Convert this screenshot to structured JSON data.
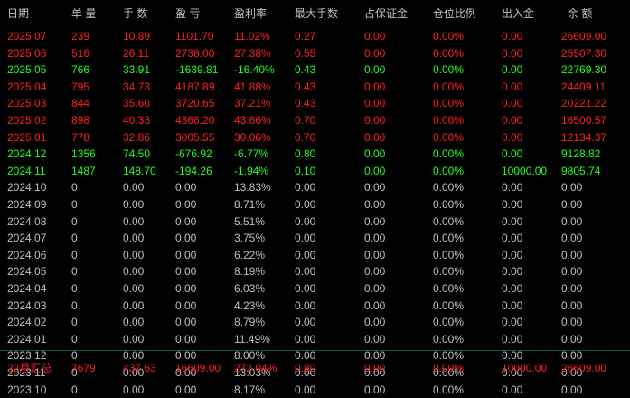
{
  "columns": [
    "日期",
    "单 量",
    "手 数",
    "盈 亏",
    "盈利率",
    "最大手数",
    "占保证金",
    "仓位比例",
    "出入金",
    "余 额"
  ],
  "rows": [
    {
      "cls": "red",
      "cells": [
        "2025.07",
        "239",
        "10.89",
        "1101.70",
        "11.02%",
        "0.27",
        "0.00",
        "0.00%",
        "0.00",
        "26609.00"
      ]
    },
    {
      "cls": "red",
      "cells": [
        "2025.06",
        "516",
        "26.11",
        "2738.00",
        "27.38%",
        "0.55",
        "0.00",
        "0.00%",
        "0.00",
        "25507.30"
      ]
    },
    {
      "cls": "green",
      "cells": [
        "2025.05",
        "766",
        "33.91",
        "-1639.81",
        "-16.40%",
        "0.43",
        "0.00",
        "0.00%",
        "0.00",
        "22769.30"
      ]
    },
    {
      "cls": "red",
      "cells": [
        "2025.04",
        "795",
        "34.73",
        "4187.89",
        "41.88%",
        "0.43",
        "0.00",
        "0.00%",
        "0.00",
        "24409.11"
      ]
    },
    {
      "cls": "red",
      "cells": [
        "2025.03",
        "844",
        "35.60",
        "3720.65",
        "37.21%",
        "0.43",
        "0.00",
        "0.00%",
        "0.00",
        "20221.22"
      ]
    },
    {
      "cls": "red",
      "cells": [
        "2025.02",
        "898",
        "40.33",
        "4366.20",
        "43.66%",
        "0.70",
        "0.00",
        "0.00%",
        "0.00",
        "16500.57"
      ]
    },
    {
      "cls": "red",
      "cells": [
        "2025.01",
        "778",
        "32.86",
        "3005.55",
        "30.06%",
        "0.70",
        "0.00",
        "0.00%",
        "0.00",
        "12134.37"
      ]
    },
    {
      "cls": "green",
      "cells": [
        "2024.12",
        "1356",
        "74.50",
        "-676.92",
        "-6.77%",
        "0.80",
        "0.00",
        "0.00%",
        "0.00",
        "9128.82"
      ]
    },
    {
      "cls": "green",
      "cells": [
        "2024.11",
        "1487",
        "148.70",
        "-194.26",
        "-1.94%",
        "0.10",
        "0.00",
        "0.00%",
        "10000.00",
        "9805.74"
      ]
    },
    {
      "cls": "gray",
      "cells": [
        "2024.10",
        "0",
        "0.00",
        "0.00",
        "13.83%",
        "0.00",
        "0.00",
        "0.00%",
        "0.00",
        "0.00"
      ]
    },
    {
      "cls": "gray",
      "cells": [
        "2024.09",
        "0",
        "0.00",
        "0.00",
        "8.71%",
        "0.00",
        "0.00",
        "0.00%",
        "0.00",
        "0.00"
      ]
    },
    {
      "cls": "gray",
      "cells": [
        "2024.08",
        "0",
        "0.00",
        "0.00",
        "5.51%",
        "0.00",
        "0.00",
        "0.00%",
        "0.00",
        "0.00"
      ]
    },
    {
      "cls": "gray",
      "cells": [
        "2024.07",
        "0",
        "0.00",
        "0.00",
        "3.75%",
        "0.00",
        "0.00",
        "0.00%",
        "0.00",
        "0.00"
      ]
    },
    {
      "cls": "gray",
      "cells": [
        "2024.06",
        "0",
        "0.00",
        "0.00",
        "6.22%",
        "0.00",
        "0.00",
        "0.00%",
        "0.00",
        "0.00"
      ]
    },
    {
      "cls": "gray",
      "cells": [
        "2024.05",
        "0",
        "0.00",
        "0.00",
        "8.19%",
        "0.00",
        "0.00",
        "0.00%",
        "0.00",
        "0.00"
      ]
    },
    {
      "cls": "gray",
      "cells": [
        "2024.04",
        "0",
        "0.00",
        "0.00",
        "6.03%",
        "0.00",
        "0.00",
        "0.00%",
        "0.00",
        "0.00"
      ]
    },
    {
      "cls": "gray",
      "cells": [
        "2024.03",
        "0",
        "0.00",
        "0.00",
        "4.23%",
        "0.00",
        "0.00",
        "0.00%",
        "0.00",
        "0.00"
      ]
    },
    {
      "cls": "gray",
      "cells": [
        "2024.02",
        "0",
        "0.00",
        "0.00",
        "8.79%",
        "0.00",
        "0.00",
        "0.00%",
        "0.00",
        "0.00"
      ]
    },
    {
      "cls": "gray",
      "cells": [
        "2024.01",
        "0",
        "0.00",
        "0.00",
        "11.49%",
        "0.00",
        "0.00",
        "0.00%",
        "0.00",
        "0.00"
      ]
    },
    {
      "cls": "gray",
      "cells": [
        "2023.12",
        "0",
        "0.00",
        "0.00",
        "8.00%",
        "0.00",
        "0.00",
        "0.00%",
        "0.00",
        "0.00"
      ]
    },
    {
      "cls": "gray",
      "cells": [
        "2023.11",
        "0",
        "0.00",
        "0.00",
        "13.03%",
        "0.00",
        "0.00",
        "0.00%",
        "0.00",
        "0.00"
      ]
    },
    {
      "cls": "gray",
      "cells": [
        "2023.10",
        "0",
        "0.00",
        "0.00",
        "8.17%",
        "0.00",
        "0.00",
        "0.00%",
        "0.00",
        "0.00"
      ]
    }
  ],
  "summary": {
    "cls": "red",
    "cells": [
      "22月汇总",
      "7679",
      "437.63",
      "16609.00",
      "272.04%",
      "0.80",
      "0.00",
      "0.00%",
      "10000.00",
      "26609.00"
    ]
  },
  "colors": {
    "positive": "#ff2020",
    "negative": "#20ff20",
    "neutral": "#c0c0c0",
    "background": "#000000",
    "divider": "#1f4f5e"
  }
}
